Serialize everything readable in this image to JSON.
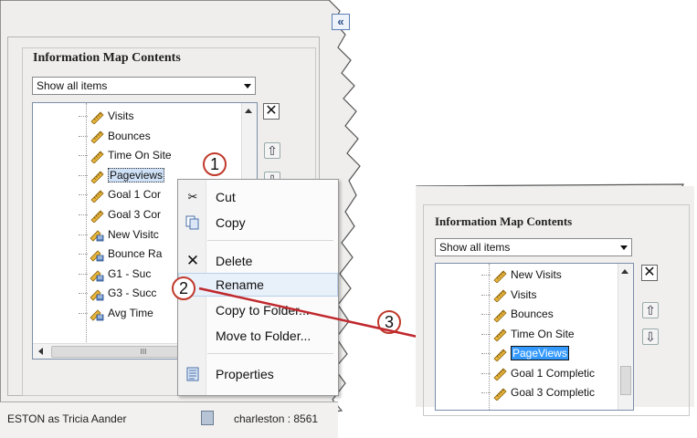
{
  "left": {
    "collapse_label": "«",
    "heading": "Information Map Contents",
    "filter": {
      "value": "Show all items"
    },
    "tree_items": [
      {
        "label": "Visits",
        "icon": "measure-ruler-icon"
      },
      {
        "label": "Bounces",
        "icon": "measure-ruler-icon"
      },
      {
        "label": "Time On Site",
        "icon": "measure-ruler-icon"
      },
      {
        "label": "Pageviews",
        "icon": "measure-ruler-icon",
        "selected": true
      },
      {
        "label": "Goal 1 Cor",
        "icon": "measure-ruler-icon"
      },
      {
        "label": "Goal 3 Cor",
        "icon": "measure-ruler-icon"
      },
      {
        "label": "New Visitc",
        "icon": "calculated-measure-icon"
      },
      {
        "label": "Bounce Ra",
        "icon": "calculated-measure-icon"
      },
      {
        "label": "G1 - Suc",
        "icon": "calculated-measure-icon"
      },
      {
        "label": "G3 - Succ",
        "icon": "calculated-measure-icon"
      },
      {
        "label": "Avg Time",
        "icon": "calculated-measure-icon"
      }
    ],
    "hscroll_thumb_label": "III",
    "status": {
      "left": "ESTON as Tricia Aander",
      "right": "charleston : 8561"
    }
  },
  "context_menu": {
    "items": [
      {
        "label": "Cut",
        "icon": "scissors-icon"
      },
      {
        "label": "Copy",
        "icon": "copy-icon"
      },
      {
        "label": "Delete",
        "icon": "delete-x-icon"
      },
      {
        "label": "Rename",
        "icon": ""
      },
      {
        "label": "Copy to Folder...",
        "icon": ""
      },
      {
        "label": "Move to Folder...",
        "icon": ""
      },
      {
        "label": "Properties",
        "icon": "properties-icon"
      }
    ],
    "highlighted": "Rename"
  },
  "callouts": [
    "1",
    "2",
    "3"
  ],
  "right": {
    "heading": "Information Map Contents",
    "filter": {
      "value": "Show all items"
    },
    "tree_items": [
      {
        "label": "New Visits",
        "icon": "measure-ruler-icon"
      },
      {
        "label": "Visits",
        "icon": "measure-ruler-icon"
      },
      {
        "label": "Bounces",
        "icon": "measure-ruler-icon"
      },
      {
        "label": "Time On Site",
        "icon": "measure-ruler-icon"
      },
      {
        "label": "PageViews",
        "icon": "measure-ruler-icon",
        "editing": true
      },
      {
        "label": "Goal 1 Completic",
        "icon": "measure-ruler-icon"
      },
      {
        "label": "Goal 3 Completic",
        "icon": "measure-ruler-icon"
      }
    ]
  },
  "colors": {
    "arrow": "#c0282d",
    "callout_border": "#c0392b",
    "selection": "#3399ff"
  }
}
